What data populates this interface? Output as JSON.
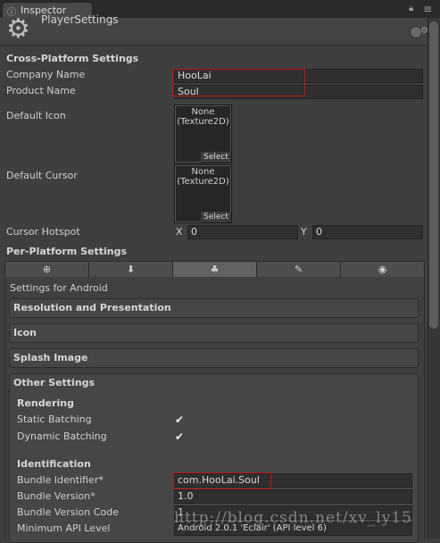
{
  "window": {
    "tab_label": "Inspector",
    "header_title": "PlayerSettings"
  },
  "cross_platform": {
    "heading": "Cross-Platform Settings",
    "company_label": "Company Name",
    "company_value": "HooLai",
    "product_label": "Product Name",
    "product_value": "Soul",
    "icon_label": "Default Icon",
    "cursor_label": "Default Cursor",
    "texture_none": "None",
    "texture_type": "(Texture2D)",
    "select_label": "Select",
    "hotspot_label": "Cursor Hotspot",
    "hotspot_x_label": "X",
    "hotspot_x_value": "0",
    "hotspot_y_label": "Y",
    "hotspot_y_value": "0"
  },
  "per_platform": {
    "heading": "Per-Platform Settings",
    "tabs": [
      {
        "icon": "globe-icon",
        "glyph": "⊕"
      },
      {
        "icon": "download-icon",
        "glyph": "⬇"
      },
      {
        "icon": "android-icon",
        "glyph": "♣",
        "active": true
      },
      {
        "icon": "brush-icon",
        "glyph": "✎"
      },
      {
        "icon": "circle-icon",
        "glyph": "◉"
      }
    ],
    "settings_for": "Settings for Android",
    "sections": {
      "resolution": "Resolution and Presentation",
      "icon": "Icon",
      "splash": "Splash Image",
      "other": "Other Settings"
    }
  },
  "other_settings": {
    "rendering_heading": "Rendering",
    "static_batching_label": "Static Batching",
    "static_batching": true,
    "dynamic_batching_label": "Dynamic Batching",
    "dynamic_batching": true,
    "identification_heading": "Identification",
    "bundle_id_label": "Bundle Identifier*",
    "bundle_id_value": "com.HooLai.Soul",
    "bundle_version_label": "Bundle Version*",
    "bundle_version_value": "1.0",
    "bundle_code_label": "Bundle Version Code",
    "bundle_code_value": "1",
    "min_api_label": "Minimum API Level",
    "min_api_value": "Android 2.0.1 'Eclair' (API level 6)"
  },
  "colors": {
    "highlight": "#c51212",
    "background": "#3f3f3f"
  },
  "watermark": "http://blog.csdn.net/xv_ly15"
}
